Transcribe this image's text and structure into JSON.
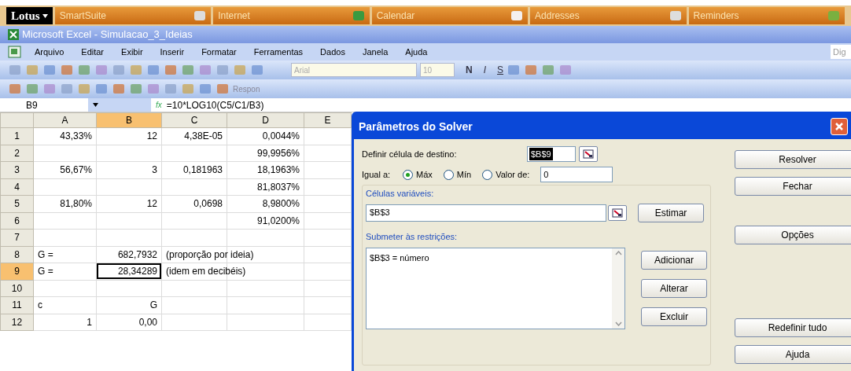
{
  "launcher": {
    "brand": "Lotus",
    "items": [
      {
        "label": "SmartSuite"
      },
      {
        "label": "Internet"
      },
      {
        "label": "Calendar"
      },
      {
        "label": "Addresses"
      },
      {
        "label": "Reminders"
      }
    ]
  },
  "window": {
    "title": "Microsoft Excel - Simulacao_3_Ideias"
  },
  "menu": [
    "Arquivo",
    "Editar",
    "Exibir",
    "Inserir",
    "Formatar",
    "Ferramentas",
    "Dados",
    "Janela",
    "Ajuda"
  ],
  "help_box": {
    "placeholder": "Dig"
  },
  "toolbar": {
    "font": "Arial",
    "size": "10",
    "bold": "N",
    "italic": "I",
    "underline": "S",
    "reply": "Respon"
  },
  "formula_bar": {
    "name_box": "B9",
    "fx": "fx",
    "formula": "=10*LOG10(C5/C1/B3)"
  },
  "sheet": {
    "columns": [
      "A",
      "B",
      "C",
      "D",
      "E"
    ],
    "rows": [
      {
        "header": "1",
        "cells": [
          {
            "text": "43,33%",
            "selected": false
          },
          {
            "text": "12",
            "selected": false
          },
          {
            "text": "4,38E-05",
            "selected": false
          },
          {
            "text": "0,0044%",
            "selected": false
          },
          {
            "text": "",
            "selected": false
          }
        ]
      },
      {
        "header": "2",
        "cells": [
          {
            "text": "",
            "selected": false
          },
          {
            "text": "",
            "selected": false
          },
          {
            "text": "",
            "selected": false
          },
          {
            "text": "99,9956%",
            "selected": false
          },
          {
            "text": "",
            "selected": false
          }
        ]
      },
      {
        "header": "3",
        "cells": [
          {
            "text": "56,67%",
            "selected": false
          },
          {
            "text": "3",
            "selected": false
          },
          {
            "text": "0,181963",
            "selected": false
          },
          {
            "text": "18,1963%",
            "selected": false
          },
          {
            "text": "",
            "selected": false
          }
        ]
      },
      {
        "header": "4",
        "cells": [
          {
            "text": "",
            "selected": false
          },
          {
            "text": "",
            "selected": false
          },
          {
            "text": "",
            "selected": false
          },
          {
            "text": "81,8037%",
            "selected": false
          },
          {
            "text": "",
            "selected": false
          }
        ]
      },
      {
        "header": "5",
        "cells": [
          {
            "text": "81,80%",
            "selected": false
          },
          {
            "text": "12",
            "selected": false
          },
          {
            "text": "0,0698",
            "selected": false
          },
          {
            "text": "8,9800%",
            "selected": false
          },
          {
            "text": "",
            "selected": false
          }
        ]
      },
      {
        "header": "6",
        "cells": [
          {
            "text": "",
            "selected": false
          },
          {
            "text": "",
            "selected": false
          },
          {
            "text": "",
            "selected": false
          },
          {
            "text": "91,0200%",
            "selected": false
          },
          {
            "text": "",
            "selected": false
          }
        ]
      },
      {
        "header": "7",
        "cells": [
          {
            "text": "",
            "selected": false
          },
          {
            "text": "",
            "selected": false
          },
          {
            "text": "",
            "selected": false
          },
          {
            "text": "",
            "selected": false
          },
          {
            "text": "",
            "selected": false
          }
        ]
      },
      {
        "header": "8",
        "cells": [
          {
            "text": "G =",
            "selected": false
          },
          {
            "text": "682,7932",
            "selected": false
          },
          {
            "text": "(proporção por ideia)",
            "selected": false
          },
          {
            "text": "",
            "selected": false
          },
          {
            "text": "",
            "selected": false
          }
        ]
      },
      {
        "header": "9",
        "cells": [
          {
            "text": "G =",
            "selected": false
          },
          {
            "text": "28,34289",
            "selected": true
          },
          {
            "text": "(idem em decibéis)",
            "selected": false
          },
          {
            "text": "",
            "selected": false
          },
          {
            "text": "",
            "selected": false
          }
        ]
      },
      {
        "header": "10",
        "cells": [
          {
            "text": "",
            "selected": false
          },
          {
            "text": "",
            "selected": false
          },
          {
            "text": "",
            "selected": false
          },
          {
            "text": "",
            "selected": false
          },
          {
            "text": "",
            "selected": false
          }
        ]
      },
      {
        "header": "11",
        "cells": [
          {
            "text": "c",
            "selected": false
          },
          {
            "text": "G",
            "selected": false
          },
          {
            "text": "",
            "selected": false
          },
          {
            "text": "",
            "selected": false
          },
          {
            "text": "",
            "selected": false
          }
        ]
      },
      {
        "header": "12",
        "cells": [
          {
            "text": "1",
            "selected": false
          },
          {
            "text": "0,00",
            "selected": false
          },
          {
            "text": "",
            "selected": false
          },
          {
            "text": "",
            "selected": false
          },
          {
            "text": "",
            "selected": false
          }
        ]
      }
    ]
  },
  "dialog": {
    "title": "Parâmetros do Solver",
    "target_label": "Definir célula de destino:",
    "target": "$B$9",
    "equal_label": "Igual a:",
    "options": [
      {
        "label": "Máx",
        "selected": true
      },
      {
        "label": "Mín",
        "selected": false
      },
      {
        "label": "Valor de:",
        "selected": false
      }
    ],
    "value": "0",
    "variables_label": "Células variáveis:",
    "variables": "$B$3",
    "guess": "Estimar",
    "constraints_label": "Submeter às restrições:",
    "constraints": [
      "$B$3 = número"
    ],
    "list_buttons": [
      "Adicionar",
      "Alterar",
      "Excluir"
    ],
    "side_buttons": [
      [
        "Resolver",
        "Fechar"
      ],
      [
        "Opções"
      ],
      [
        "Redefinir tudo",
        "Ajuda"
      ]
    ]
  }
}
